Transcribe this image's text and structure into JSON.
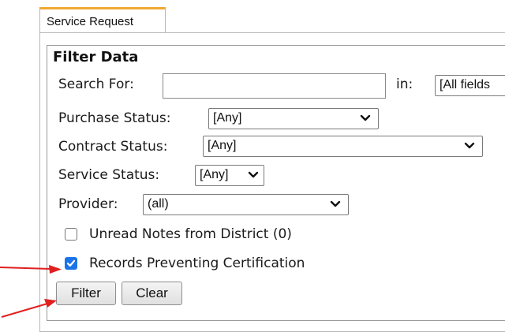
{
  "tab": {
    "label": "Service Request"
  },
  "filter": {
    "title": "Filter Data",
    "search_label": "Search For:",
    "search_value": "",
    "in_label": "in:",
    "in_value": "[All fields",
    "purchase_status_label": "Purchase Status:",
    "purchase_status_value": "[Any]",
    "contract_status_label": "Contract Status:",
    "contract_status_value": "[Any]",
    "service_status_label": "Service Status:",
    "service_status_value": "[Any]",
    "provider_label": "Provider:",
    "provider_value": "(all)",
    "unread_notes_label": "Unread Notes from District (0)",
    "unread_notes_checked": false,
    "records_preventing_label": "Records Preventing Certification",
    "records_preventing_checked": true,
    "filter_button": "Filter",
    "clear_button": "Clear"
  },
  "colors": {
    "tab_accent": "#f0a830",
    "checkbox_checked": "#1a73e8",
    "annotation_arrow": "#e02020"
  }
}
